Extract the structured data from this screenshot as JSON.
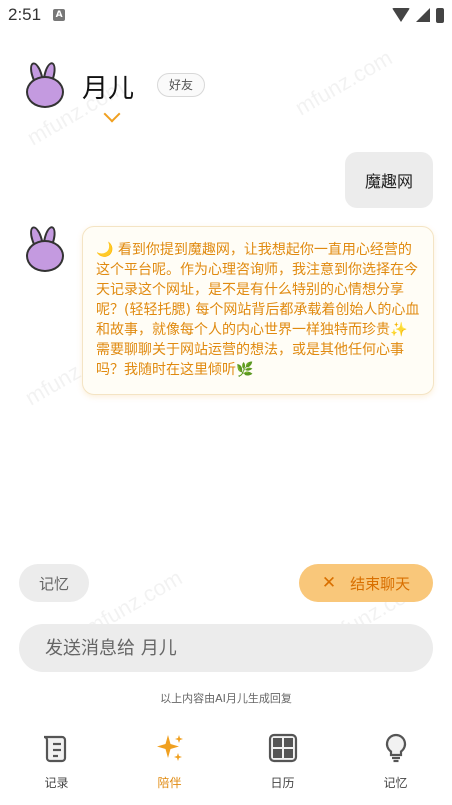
{
  "status_bar": {
    "time": "2:51"
  },
  "header": {
    "name": "月儿",
    "badge": "好友"
  },
  "messages": {
    "user": "魔趣网",
    "bot": "🌙 看到你提到魔趣网，让我想起你一直用心经营的这个平台呢。作为心理咨询师，我注意到你选择在今天记录这个网址，是不是有什么特别的心情想分享呢？(轻轻托腮) 每个网站背后都承载着创始人的心血和故事，就像每个人的内心世界一样独特而珍贵✨需要聊聊关于网站运营的想法，或是其他任何心事吗？我随时在这里倾听🌿"
  },
  "actions": {
    "memory": "记忆",
    "end_chat": "结束聊天"
  },
  "input": {
    "placeholder": "发送消息给 月儿"
  },
  "notice": "以上内容由AI月儿生成回复",
  "nav": [
    {
      "label": "记录",
      "icon": "scroll-icon"
    },
    {
      "label": "陪伴",
      "icon": "sparkle-icon"
    },
    {
      "label": "日历",
      "icon": "calendar-icon"
    },
    {
      "label": "记忆",
      "icon": "lightbulb-icon"
    }
  ],
  "colors": {
    "accent": "#e08a10",
    "end_chat_bg": "#f9c77a",
    "avatar": "#c49ae0"
  },
  "watermark": "mfunz.com"
}
